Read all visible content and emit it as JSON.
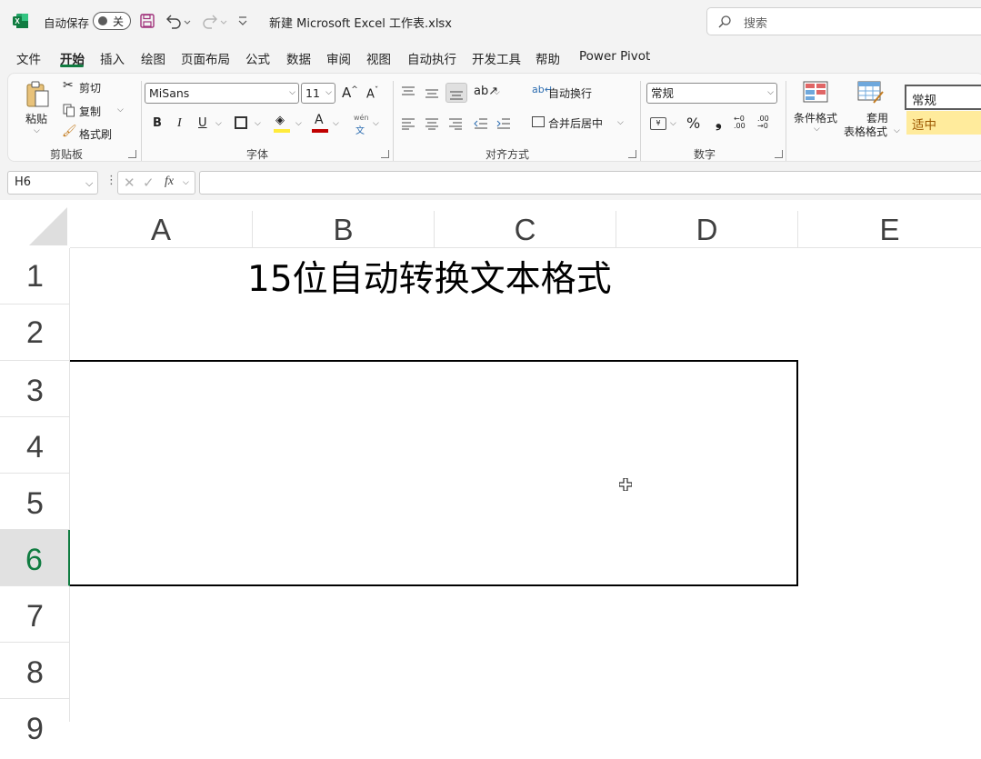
{
  "titlebar": {
    "autosave_label": "自动保存",
    "autosave_state": "关",
    "filename": "新建 Microsoft Excel 工作表.xlsx",
    "search_placeholder": "搜索",
    "icons": [
      "excel-logo-icon",
      "save-icon",
      "undo-icon",
      "redo-icon",
      "customize-qat-icon",
      "search-icon"
    ]
  },
  "menu": {
    "items": [
      "文件",
      "开始",
      "插入",
      "绘图",
      "页面布局",
      "公式",
      "数据",
      "审阅",
      "视图",
      "自动执行",
      "开发工具",
      "帮助",
      "Power Pivot"
    ],
    "active": "开始"
  },
  "ribbon": {
    "clipboard": {
      "paste": "粘贴",
      "cut": "剪切",
      "copy": "复制",
      "format_painter": "格式刷",
      "label": "剪贴板"
    },
    "font": {
      "name": "MiSans",
      "size": "11",
      "bold": "B",
      "italic": "I",
      "underline": "U",
      "label": "字体",
      "phonetic_top": "wén",
      "phonetic_bottom": "文"
    },
    "alignment": {
      "wrap": "自动换行",
      "merge": "合并后居中",
      "label": "对齐方式"
    },
    "number": {
      "format": "常规",
      "percent": "%",
      "comma": "❟",
      "label": "数字",
      "inc_decimal": "←0 .00",
      "dec_decimal": ".00 →0"
    },
    "styles": {
      "conditional": "条件格式",
      "table_line1": "套用",
      "table_line2": "表格格式",
      "style_normal": "常规",
      "style_neutral": "适中"
    }
  },
  "formula_bar": {
    "name_box": "H6",
    "fx": "fx",
    "content": ""
  },
  "sheet": {
    "columns": [
      "A",
      "B",
      "C",
      "D",
      "E"
    ],
    "rows": [
      "1",
      "2",
      "3",
      "4",
      "5",
      "6",
      "7",
      "8",
      "9"
    ],
    "selected_row": "6",
    "cells": {
      "B1": "15位自动转换文本格式"
    }
  },
  "colors": {
    "accent": "#107c41",
    "neutral_style_bg": "#ffeb9c",
    "neutral_style_text": "#9c5700",
    "font_color": "#c00000",
    "highlight": "#ffeb3b"
  }
}
